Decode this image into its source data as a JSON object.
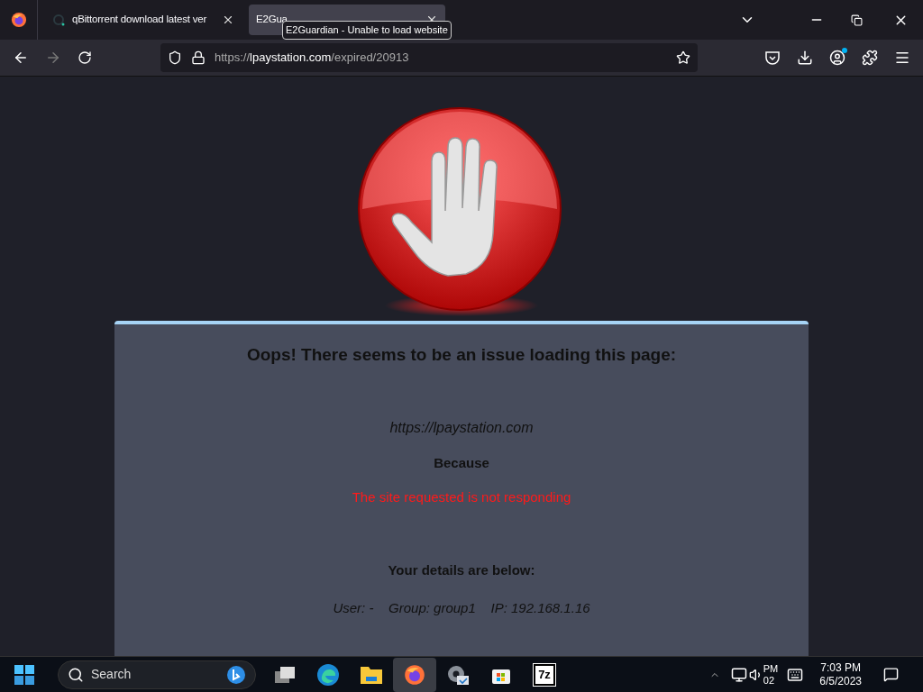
{
  "tabs": [
    {
      "label": "qBittorrent download latest ver",
      "selected": false,
      "kind": "loading"
    },
    {
      "label": "E2Gua",
      "selected": true,
      "kind": "plain"
    }
  ],
  "tooltip": "E2Guardian - Unable to load website",
  "address": {
    "scheme": "https://",
    "domain": "lpaystation.com",
    "path": "/expired/20913"
  },
  "page": {
    "heading": "Oops! There seems to be an issue loading this page:",
    "site": "https://lpaystation.com",
    "because": "Because",
    "reason": "The site requested is not responding",
    "details_heading": "Your details are below:",
    "details": "User: -    Group: group1    IP: 192.168.1.16"
  },
  "taskbar": {
    "search_placeholder": "Search",
    "apps": [
      {
        "kind": "taskview",
        "selected": false
      },
      {
        "kind": "edge",
        "selected": false
      },
      {
        "kind": "folder",
        "selected": false
      },
      {
        "kind": "firefox",
        "selected": true
      },
      {
        "kind": "settings",
        "selected": false
      },
      {
        "kind": "store",
        "selected": false
      },
      {
        "kind": "sevenzip",
        "selected": false,
        "label": "7z"
      }
    ],
    "overlap_text": [
      "PM",
      "02"
    ],
    "time": "7:03 PM",
    "date": "6/5/2023"
  }
}
